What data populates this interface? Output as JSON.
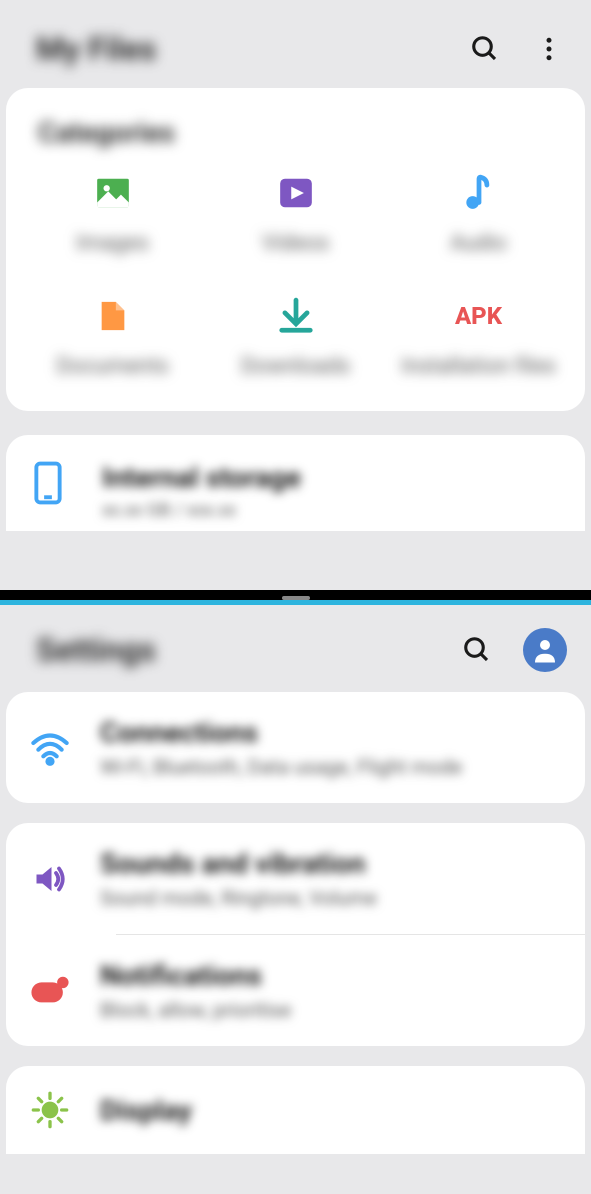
{
  "myfiles": {
    "title": "My Files",
    "categories_label": "Categories",
    "items": [
      {
        "label": "Images"
      },
      {
        "label": "Videos"
      },
      {
        "label": "Audio"
      },
      {
        "label": "Documents"
      },
      {
        "label": "Downloads"
      },
      {
        "label": "Installation files",
        "badge": "APK"
      }
    ],
    "storage": {
      "title": "Internal storage",
      "subtitle": "xx.xx GB / xxx.xx"
    }
  },
  "settings": {
    "title": "Settings",
    "groups": [
      {
        "items": [
          {
            "title": "Connections",
            "subtitle": "Wi-Fi, Bluetooth, Data usage, Flight mode"
          }
        ]
      },
      {
        "items": [
          {
            "title": "Sounds and vibration",
            "subtitle": "Sound mode, Ringtone, Volume"
          },
          {
            "title": "Notifications",
            "subtitle": "Block, allow, prioritise"
          }
        ]
      },
      {
        "items": [
          {
            "title": "Display",
            "subtitle": ""
          }
        ]
      }
    ]
  }
}
